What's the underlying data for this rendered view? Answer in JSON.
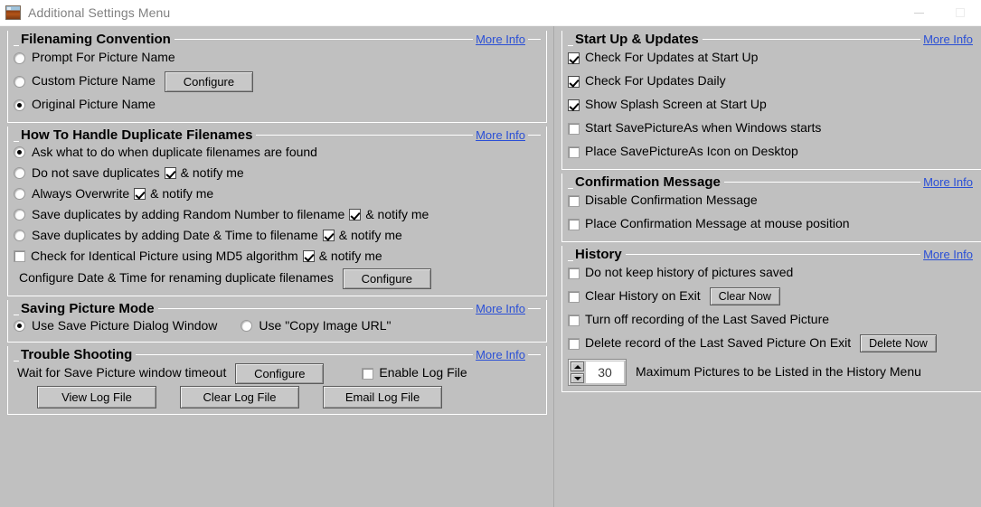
{
  "window": {
    "title": "Additional Settings Menu",
    "icon": "picture-thumbnail-icon",
    "minimize_label": "—",
    "maximize_label": "□"
  },
  "common": {
    "more_info": "More Info",
    "configure": "Configure",
    "notify_me": "& notify me"
  },
  "left": {
    "filenaming": {
      "title": "Filenaming Convention",
      "more_info": "More Info",
      "options": [
        {
          "label": "Prompt For Picture Name",
          "checked": false
        },
        {
          "label": "Custom Picture Name",
          "checked": false,
          "button": "Configure"
        },
        {
          "label": "Original Picture Name",
          "checked": true
        }
      ]
    },
    "duplicates": {
      "title": "How To Handle Duplicate Filenames",
      "more_info": "More Info",
      "options": [
        {
          "label": "Ask what to do when duplicate filenames are found",
          "checked": true
        },
        {
          "label": "Do not save duplicates",
          "checked": false,
          "notify": true,
          "notify_label": "& notify me"
        },
        {
          "label": "Always Overwrite",
          "checked": false,
          "notify": true,
          "notify_label": "& notify me"
        },
        {
          "label": "Save duplicates by adding Random Number to filename",
          "checked": false,
          "notify": true,
          "notify_label": "& notify me"
        },
        {
          "label": "Save duplicates by adding Date & Time to filename",
          "checked": false,
          "notify": true,
          "notify_label": "& notify me"
        }
      ],
      "md5": {
        "label": "Check for Identical Picture using MD5 algorithm",
        "checked": false,
        "notify": true,
        "notify_label": "& notify me"
      },
      "configure_row": {
        "label": "Configure Date & Time for renaming duplicate filenames",
        "button": "Configure"
      }
    },
    "saving_mode": {
      "title": "Saving Picture Mode",
      "more_info": "More Info",
      "options": [
        {
          "label": "Use Save Picture Dialog Window",
          "checked": true
        },
        {
          "label": "Use \"Copy Image URL\"",
          "checked": false
        }
      ]
    },
    "trouble": {
      "title": "Trouble Shooting",
      "more_info": "More Info",
      "timeout_label": "Wait for Save Picture window timeout",
      "timeout_button": "Configure",
      "enable_log": {
        "label": "Enable Log File",
        "checked": false
      },
      "buttons": [
        "View Log File",
        "Clear Log File",
        "Email Log File"
      ]
    }
  },
  "right": {
    "startup": {
      "title": "Start Up & Updates",
      "more_info": "More Info",
      "options": [
        {
          "label": "Check For Updates at Start Up",
          "checked": true
        },
        {
          "label": "Check For Updates Daily",
          "checked": true
        },
        {
          "label": "Show Splash Screen at Start Up",
          "checked": true
        },
        {
          "label": "Start SavePictureAs when Windows starts",
          "checked": false
        },
        {
          "label": "Place SavePictureAs Icon on Desktop",
          "checked": false
        }
      ]
    },
    "confirmation": {
      "title": "Confirmation Message",
      "more_info": "More Info",
      "options": [
        {
          "label": "Disable Confirmation Message",
          "checked": false
        },
        {
          "label": "Place Confirmation Message at mouse position",
          "checked": false
        }
      ]
    },
    "history": {
      "title": "History",
      "more_info": "More Info",
      "options": [
        {
          "label": "Do not keep history of pictures saved",
          "checked": false
        },
        {
          "label": "Clear History on Exit",
          "checked": false,
          "button": "Clear Now"
        },
        {
          "label": "Turn off recording of the Last Saved Picture",
          "checked": false
        },
        {
          "label": "Delete record of the Last Saved Picture On Exit",
          "checked": false,
          "button": "Delete Now"
        }
      ],
      "max_pictures": {
        "value": "30",
        "label": "Maximum Pictures to be Listed in the History Menu"
      }
    }
  },
  "colors": {
    "background": "#c0c0c0",
    "link": "#2a4fd6",
    "groupline": "#ffffff",
    "titlebar": "#ffffff",
    "title_text": "#808080"
  }
}
